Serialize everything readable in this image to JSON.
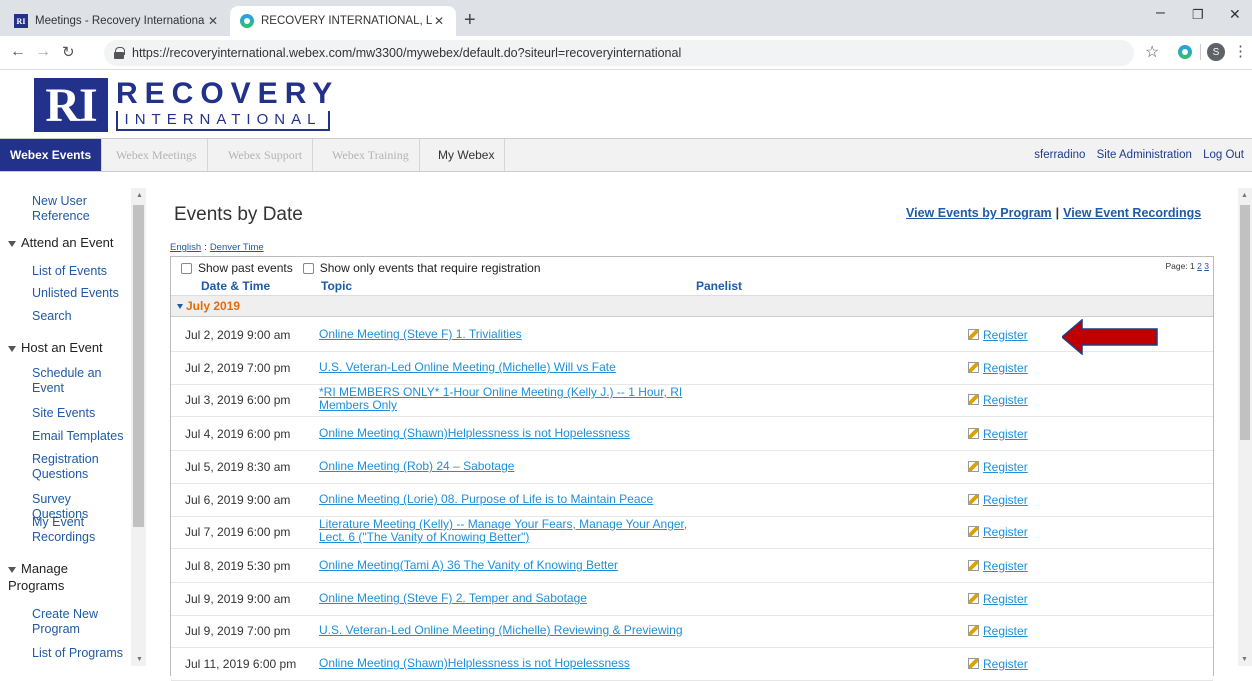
{
  "browser": {
    "tabs": [
      {
        "title": "Meetings - Recovery Internationa",
        "active": false
      },
      {
        "title": "RECOVERY INTERNATIONAL, LTD",
        "active": true
      }
    ],
    "url": "https://recoveryinternational.webex.com/mw3300/mywebex/default.do?siteurl=recoveryinternational",
    "profile_initial": "S"
  },
  "logo": {
    "mark": "RI",
    "word1": "RECOVERY",
    "word2": "INTERNATIONAL"
  },
  "nav": {
    "tabs": [
      "Webex Events",
      "Webex Meetings",
      "Webex Support",
      "Webex Training",
      "My Webex"
    ],
    "user": "sferradino",
    "site_admin": "Site Administration",
    "logout": "Log Out"
  },
  "sidebar": {
    "new_user_ref": "New User Reference",
    "attend_head": "Attend an Event",
    "list_of_events": "List of Events",
    "unlisted_events": "Unlisted Events",
    "search": "Search",
    "host_head": "Host an Event",
    "schedule": "Schedule an Event",
    "site_events": "Site Events",
    "email_templates": "Email Templates",
    "registration_questions": "Registration Questions",
    "survey_questions": "Survey Questions",
    "my_event_recordings": "My Event Recordings",
    "manage_head": "Manage Programs",
    "create_program": "Create New Program",
    "list_programs": "List of Programs"
  },
  "main": {
    "title": "Events by Date",
    "link_by_program": "View Events by Program",
    "link_recordings": "View Event Recordings",
    "link_sep": "|",
    "lang": "English",
    "locale_sep": ":",
    "tz": "Denver Time",
    "show_past": "Show past events",
    "show_reg_only": "Show only events that require registration",
    "pages_label": "Page: 1",
    "page2": "2",
    "page3": "3",
    "col_date": "Date & Time",
    "col_topic": "Topic",
    "col_panelist": "Panelist",
    "month": "July 2019",
    "register_label": "Register",
    "events": [
      {
        "date": "Jul 2, 2019  9:00 am",
        "topic": "Online Meeting (Steve F) 1. Trivialities"
      },
      {
        "date": "Jul 2, 2019  7:00 pm",
        "topic": "U.S. Veteran-Led Online Meeting (Michelle) Will vs Fate"
      },
      {
        "date": "Jul 3, 2019  6:00 pm",
        "topic": "*RI MEMBERS ONLY* 1-Hour Online Meeting (Kelly J.) -- 1 Hour, RI Members Only"
      },
      {
        "date": "Jul 4, 2019  6:00 pm",
        "topic": "Online Meeting (Shawn)Helplessness is not Hopelessness"
      },
      {
        "date": "Jul 5, 2019  8:30 am",
        "topic": "Online Meeting (Rob) 24 – Sabotage"
      },
      {
        "date": "Jul 6, 2019  9:00 am",
        "topic": "Online Meeting (Lorie) 08. Purpose of Life is to Maintain Peace"
      },
      {
        "date": "Jul 7, 2019  6:00 pm",
        "topic": "Literature Meeting (Kelly) -- Manage Your Fears, Manage Your Anger, Lect. 6 (\"The Vanity of Knowing Better\")"
      },
      {
        "date": "Jul 8, 2019  5:30 pm",
        "topic": "Online Meeting(Tami A) 36 The Vanity of Knowing Better"
      },
      {
        "date": "Jul 9, 2019  9:00 am",
        "topic": "Online Meeting (Steve F) 2. Temper and Sabotage"
      },
      {
        "date": "Jul 9, 2019  7:00 pm",
        "topic": "U.S. Veteran-Led Online Meeting (Michelle) Reviewing & Previewing"
      },
      {
        "date": "Jul 11, 2019  6:00 pm",
        "topic": "Online Meeting (Shawn)Helplessness is not Hopelessness"
      }
    ]
  },
  "colors": {
    "brand": "#22318a",
    "link": "#1f8fd9",
    "month": "#e36c0a",
    "arrow": "#c00000"
  }
}
